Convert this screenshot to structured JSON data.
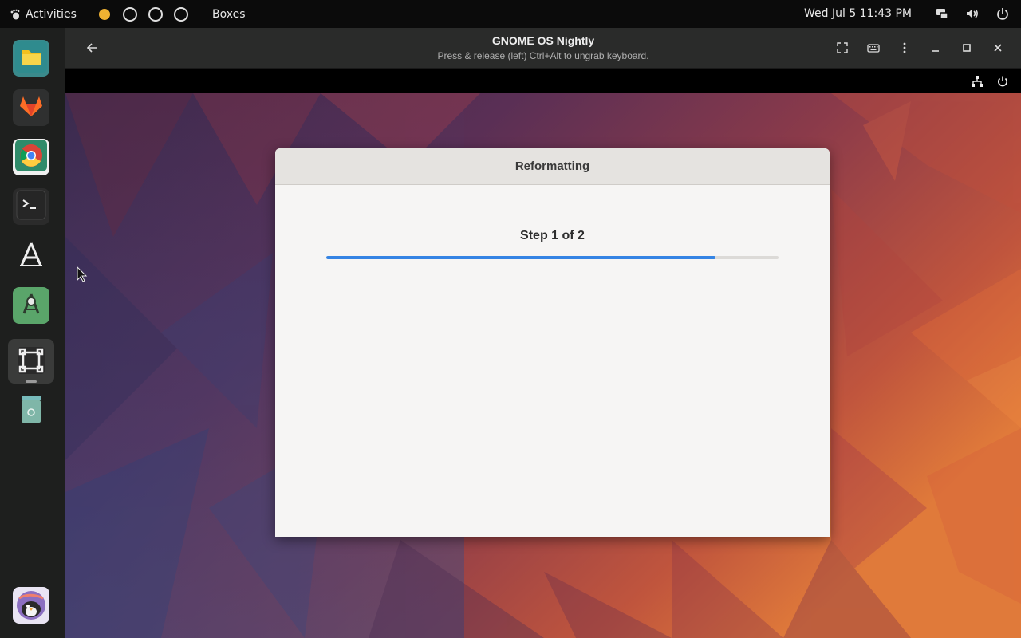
{
  "topbar": {
    "activities_label": "Activities",
    "app_name": "Boxes",
    "clock": "Wed Jul 5  11:43 PM",
    "workspaces": [
      "active",
      "inactive",
      "inactive",
      "inactive"
    ]
  },
  "dock": {
    "apps": [
      "files",
      "gitlab",
      "chrome",
      "terminal",
      "software",
      "builder",
      "boxes",
      "trash",
      "avatar"
    ]
  },
  "window": {
    "title": "GNOME OS Nightly",
    "subtitle": "Press & release (left) Ctrl+Alt to ungrab keyboard."
  },
  "dialog": {
    "title": "Reformatting",
    "step": "Step 1 of 2",
    "progress_fraction": 0.86
  },
  "colors": {
    "accent": "#3584e4",
    "workspace_active": "#f0b232"
  }
}
